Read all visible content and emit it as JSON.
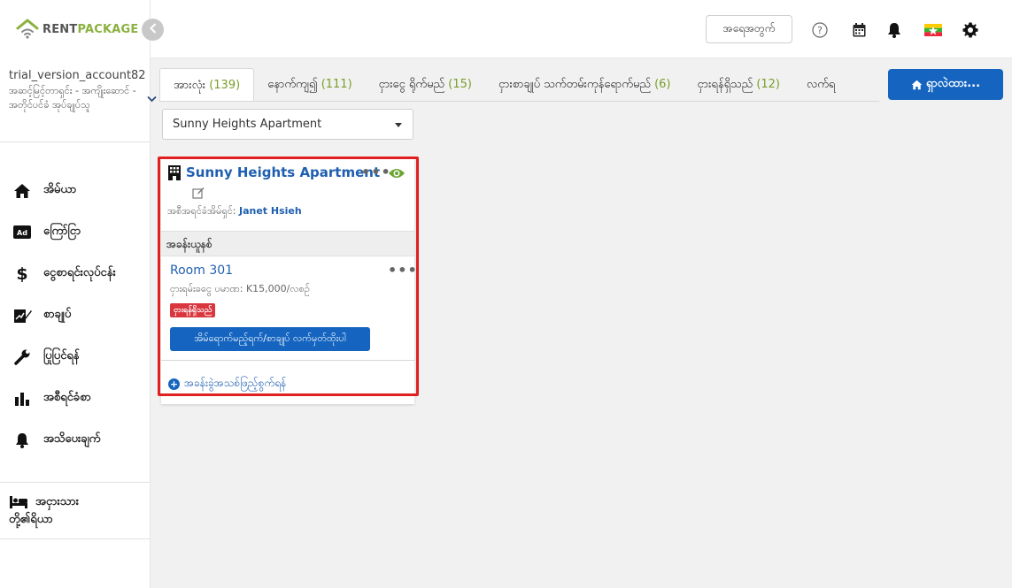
{
  "brand": {
    "name_part1": "RENT",
    "name_part2": "PACKAGE",
    "accent": "#8bb13f"
  },
  "account": {
    "name": "trial_version_account82",
    "role": "အဆင့်မြင့်တာရှင်း - အကျိုးဆောင် - အတိုင်ပင်ခံ အုပ်ချုပ်သူ"
  },
  "sidebar": {
    "items": [
      {
        "label": "အိမ်ယာ",
        "icon": "home-icon"
      },
      {
        "label": "ကြော်ငြာ",
        "icon": "ad-icon"
      },
      {
        "label": "ငွေစာရင်းလုပ်ငန်း",
        "icon": "dollar-icon"
      },
      {
        "label": "စာချုပ်",
        "icon": "contract-icon"
      },
      {
        "label": "ပြုပြင်ရန်",
        "icon": "wrench-icon"
      },
      {
        "label": "အစီရင်ခံစာ",
        "icon": "chart-icon"
      },
      {
        "label": "အသိပေးချက်",
        "icon": "bell-icon"
      }
    ],
    "extra": {
      "label_line1": "အငှားသား",
      "label_line2": "တို့၏ရိယာ",
      "icon": "bed-icon"
    }
  },
  "topbar": {
    "checkout_label": "အရေအတွက်",
    "language_flag": "myanmar-flag",
    "icons": [
      "help-icon",
      "calendar-icon",
      "bell-icon",
      "gear-icon"
    ]
  },
  "tabs": [
    {
      "label": "အားလုံး",
      "count": "(139)",
      "active": true
    },
    {
      "label": "နောက်ကျ၍",
      "count": "(111)"
    },
    {
      "label": "ငှားငွေ ရိုက်မည်",
      "count": "(15)"
    },
    {
      "label": "ငှားစာချုပ် သက်တမ်းကုန်ရောက်မည်",
      "count": "(6)"
    },
    {
      "label": "ငှားရန်ရှိသည်",
      "count": "(12)"
    },
    {
      "label": "လက်ရ",
      "count": ""
    }
  ],
  "search_button": {
    "label": "ရှာလဲထား..."
  },
  "property_select": {
    "value": "Sunny Heights Apartment"
  },
  "card": {
    "title": "Sunny Heights Apartment",
    "owner_label": "အစီအရင်ခံအိမ်ရှင်:",
    "owner_name": "Janet Hsieh",
    "section_label": "အခန်းယူနစ်",
    "room": {
      "name": "Room 301",
      "price": "ငှားရမ်းခငွေ ပမာဏ: K15,000/လစဉ်",
      "status": "ငှားရန်ရှိသည်",
      "status_color": "#d9363e",
      "action_label": "အိမ်ရောက်မည့်ရက်/စာချုပ် လက်မှတ်ထိုးပါ"
    },
    "add_room_label": "အခန်းခွဲအသစ်ဖြည့်စွက်ရန်"
  },
  "colors": {
    "primary": "#1565c0",
    "link": "#1f5fb0",
    "highlight": "#e02020",
    "success": "#7a9d2a"
  }
}
